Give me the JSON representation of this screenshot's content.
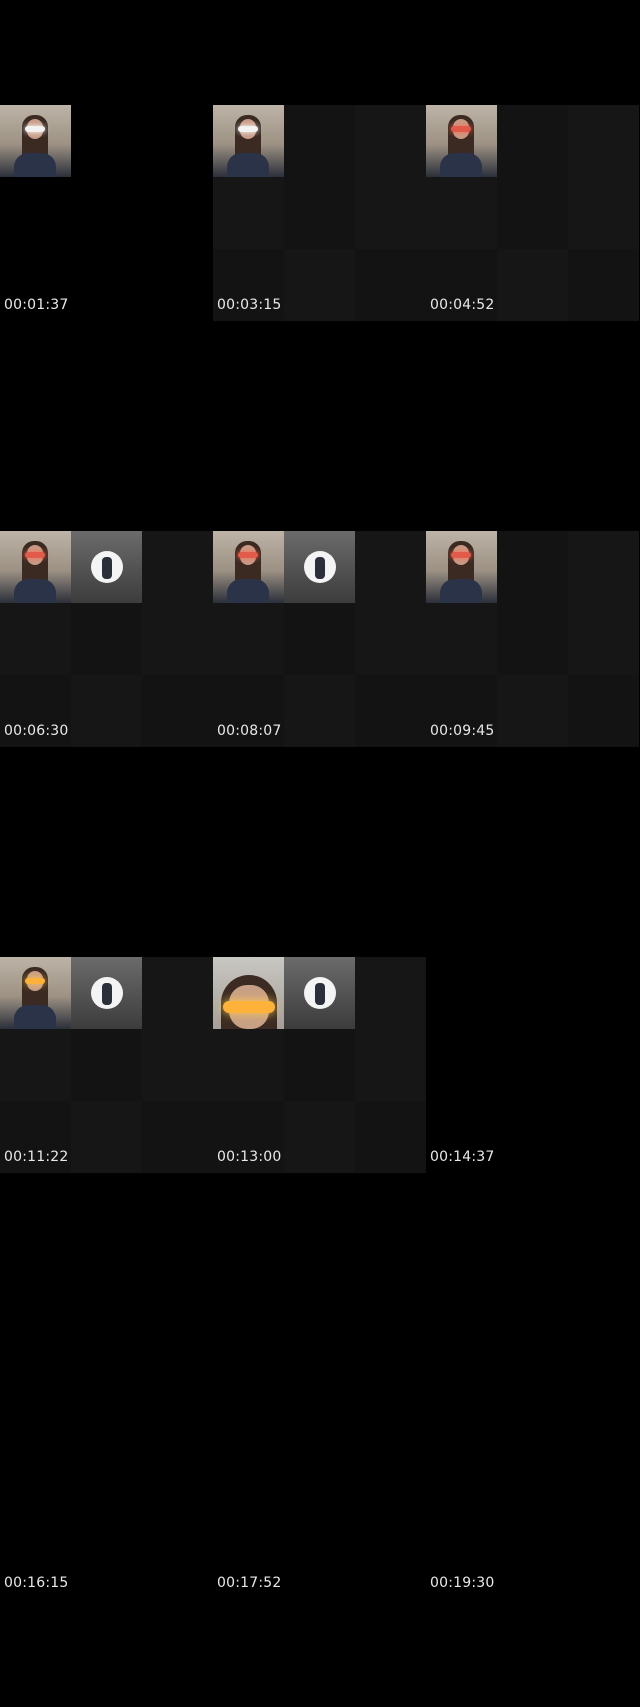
{
  "timestamps": [
    "00:01:37",
    "00:03:15",
    "00:04:52",
    "00:06:30",
    "00:08:07",
    "00:09:45",
    "00:11:22",
    "00:13:00",
    "00:14:37",
    "00:16:15",
    "00:17:52",
    "00:19:30"
  ],
  "thumbnail_kinds": {
    "person_white_mask": "person-wearing-white-mask",
    "person_red_mask": "person-wearing-red-mask",
    "person_gold_mask": "person-wearing-gold-mask",
    "avatar": "profile-avatar",
    "closeup_gold_mask": "closeup-person-gold-mask"
  },
  "colors": {
    "background": "#000000",
    "tile": "#131313",
    "timestamp_text": "#e9e9e9"
  }
}
